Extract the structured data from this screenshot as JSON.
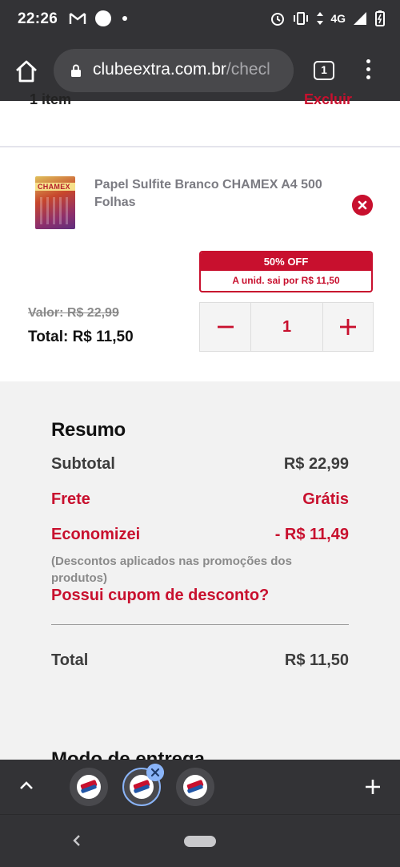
{
  "status_bar": {
    "time": "22:26",
    "network": "4G"
  },
  "browser": {
    "url_host": "clubeextra.com.br",
    "url_path": "/checl",
    "tab_count": "1"
  },
  "cart": {
    "header_left": "1 item",
    "header_right": "Excluir",
    "product": {
      "name": "Papel Sulfite Branco CHAMEX A4 500 Folhas",
      "image_brand_text": "CHAMEX",
      "discount_badge": "50% OFF",
      "unit_price_text": "A unid. sai por ",
      "unit_price_value": "R$ 11,50",
      "old_price": "Valor: R$ 22,99",
      "total": "Total: R$ 11,50",
      "quantity": "1"
    }
  },
  "summary": {
    "title": "Resumo",
    "subtotal_label": "Subtotal",
    "subtotal_value": "R$ 22,99",
    "shipping_label": "Frete",
    "shipping_value": "Grátis",
    "savings_label": "Economizei",
    "savings_value": "- R$ 11,49",
    "savings_note": "(Descontos aplicados nas promoções dos produtos)",
    "coupon_link": "Possui cupom de desconto?",
    "total_label": "Total",
    "total_value": "R$ 11,50",
    "next_section": "Modo de entrega"
  },
  "colors": {
    "accent": "#c8102e",
    "chrome": "#333336",
    "tab_highlight": "#8ab4f8"
  },
  "icons": [
    "home-icon",
    "lock-icon",
    "tabs-icon",
    "more-vert-icon",
    "remove-icon",
    "minus-icon",
    "plus-icon",
    "chevron-up-icon",
    "close-icon",
    "add-tab-icon",
    "back-icon"
  ]
}
